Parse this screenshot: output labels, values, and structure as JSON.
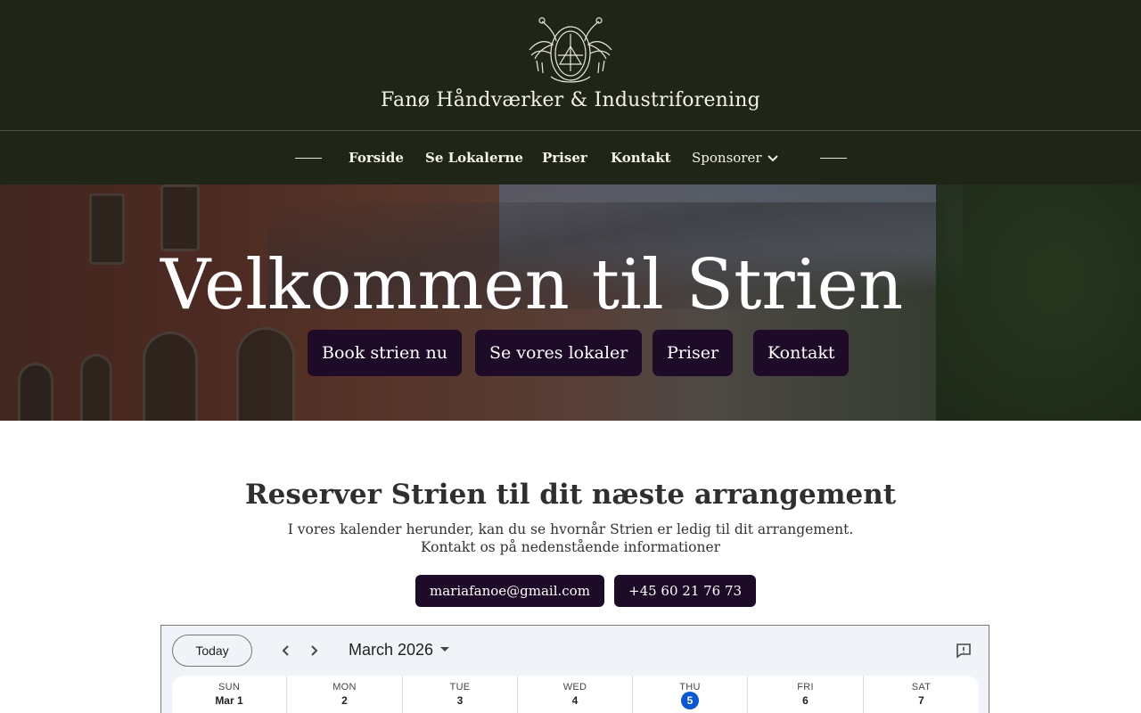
{
  "site": {
    "title": "Fanø Håndværker & Industriforening"
  },
  "nav": {
    "items": [
      {
        "label": "Forside"
      },
      {
        "label": "Se Lokalerne"
      },
      {
        "label": "Priser"
      },
      {
        "label": "Kontakt"
      },
      {
        "label": "Sponsorer"
      }
    ]
  },
  "hero": {
    "title": "Velkommen til Strien",
    "buttons": [
      {
        "label": "Book strien nu"
      },
      {
        "label": "Se vores lokaler"
      },
      {
        "label": "Priser"
      },
      {
        "label": "Kontakt"
      }
    ]
  },
  "reserve": {
    "title": "Reserver Strien til dit næste arrangement",
    "line1": "I vores kalender herunder, kan du se hvornår Strien er ledig til dit arrangement.",
    "line2": "Kontakt os på nedenstående informationer",
    "email": "mariafanoe@gmail.com",
    "phone": "+45 60 21 76 73"
  },
  "calendar": {
    "today_label": "Today",
    "month": "March 2026",
    "days": [
      {
        "dow": "SUN",
        "date": "Mar 1"
      },
      {
        "dow": "MON",
        "date": "2"
      },
      {
        "dow": "TUE",
        "date": "3"
      },
      {
        "dow": "WED",
        "date": "4"
      },
      {
        "dow": "THU",
        "date": "5",
        "today": true
      },
      {
        "dow": "FRI",
        "date": "6"
      },
      {
        "dow": "SAT",
        "date": "7"
      }
    ],
    "colors": {
      "today": "#0b57d0"
    }
  },
  "colors": {
    "header_bg": "#1f2618",
    "button_bg": "#1e0b28"
  }
}
